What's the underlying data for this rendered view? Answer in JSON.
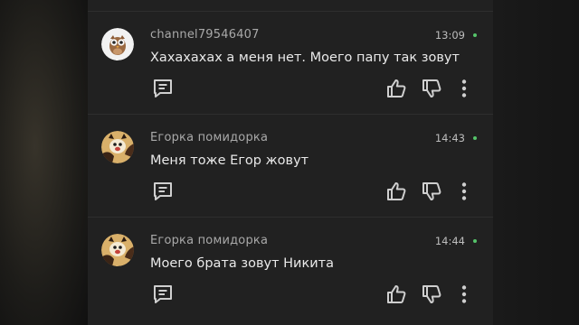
{
  "colors": {
    "panel_bg": "#212121",
    "author_text": "#a9a9a9",
    "body_text": "#e9e9e9",
    "online_dot": "#55c46a"
  },
  "comments": [
    {
      "author": "channel79546407",
      "time": "13:09",
      "text": "Хахахахах а меня нет. Моего папу так зовут",
      "avatar": "owl-avatar"
    },
    {
      "author": "Егорка помидорка",
      "time": "14:43",
      "text": "Меня тоже Егор жовут",
      "avatar": "cat-avatar"
    },
    {
      "author": "Егорка помидорка",
      "time": "14:44",
      "text": "Моего брата зовут Никита",
      "avatar": "cat-avatar"
    }
  ],
  "icons": {
    "reply": "reply-icon",
    "like": "thumbs-up-icon",
    "dislike": "thumbs-down-icon",
    "more": "more-vertical-icon"
  }
}
